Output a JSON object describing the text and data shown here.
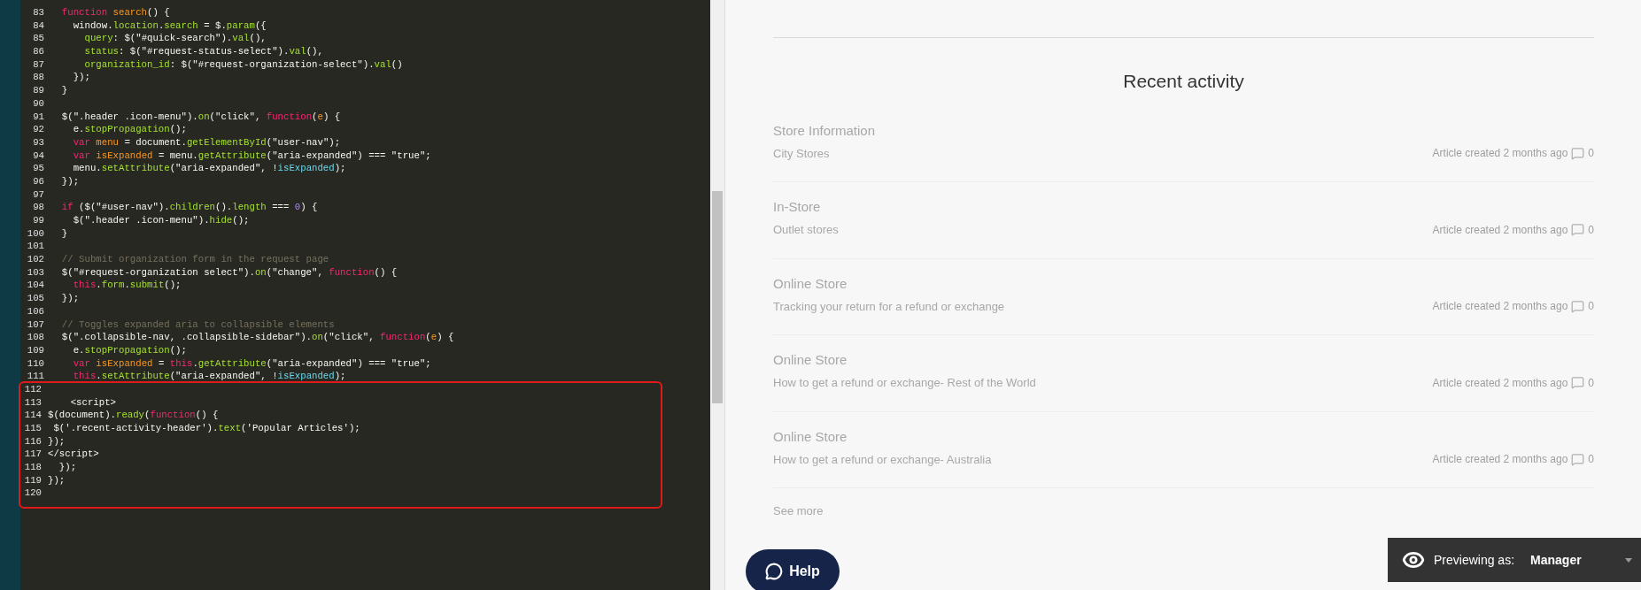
{
  "editor": {
    "code_blocks": [
      {
        "highlighted": false,
        "lines": [
          {
            "number": "83",
            "tokens": [
              {
                "kind": "kw",
                "text": "  function"
              },
              {
                "kind": "name",
                "text": " search"
              },
              {
                "kind": "plain",
                "text": "() {"
              }
            ]
          },
          {
            "number": "84",
            "tokens": [
              {
                "kind": "plain",
                "text": "    window."
              },
              {
                "kind": "fn",
                "text": "location"
              },
              {
                "kind": "plain",
                "text": "."
              },
              {
                "kind": "fn",
                "text": "search"
              },
              {
                "kind": "plain",
                "text": " = $."
              },
              {
                "kind": "fn",
                "text": "param"
              },
              {
                "kind": "plain",
                "text": "({"
              }
            ]
          },
          {
            "number": "85",
            "tokens": [
              {
                "kind": "fn",
                "text": "      query"
              },
              {
                "kind": "plain",
                "text": ": $(\"#quick-search\")."
              },
              {
                "kind": "fn",
                "text": "val"
              },
              {
                "kind": "plain",
                "text": "(),"
              }
            ]
          },
          {
            "number": "86",
            "tokens": [
              {
                "kind": "fn",
                "text": "      status"
              },
              {
                "kind": "plain",
                "text": ": $(\"#request-status-select\")."
              },
              {
                "kind": "fn",
                "text": "val"
              },
              {
                "kind": "plain",
                "text": "(),"
              }
            ]
          },
          {
            "number": "87",
            "tokens": [
              {
                "kind": "fn",
                "text": "      organization_id"
              },
              {
                "kind": "plain",
                "text": ": $(\"#request-organization-select\")."
              },
              {
                "kind": "fn",
                "text": "val"
              },
              {
                "kind": "plain",
                "text": "()"
              }
            ]
          },
          {
            "number": "88",
            "tokens": [
              {
                "kind": "plain",
                "text": "    });"
              }
            ]
          },
          {
            "number": "89",
            "tokens": [
              {
                "kind": "plain",
                "text": "  }"
              }
            ]
          },
          {
            "number": "90"
          },
          {
            "number": "91",
            "tokens": [
              {
                "kind": "plain",
                "text": "  $(\".header .icon-menu\")."
              },
              {
                "kind": "fn",
                "text": "on"
              },
              {
                "kind": "plain",
                "text": "(\"click\", "
              },
              {
                "kind": "kw",
                "text": "function"
              },
              {
                "kind": "plain",
                "text": "("
              },
              {
                "kind": "name",
                "text": "e"
              },
              {
                "kind": "plain",
                "text": ") {"
              }
            ]
          },
          {
            "number": "92",
            "tokens": [
              {
                "kind": "plain",
                "text": "    e."
              },
              {
                "kind": "fn",
                "text": "stopPropagation"
              },
              {
                "kind": "plain",
                "text": "();"
              }
            ]
          },
          {
            "number": "93",
            "tokens": [
              {
                "kind": "kw",
                "text": "    var"
              },
              {
                "kind": "name",
                "text": " menu"
              },
              {
                "kind": "plain",
                "text": " = document."
              },
              {
                "kind": "fn",
                "text": "getElementById"
              },
              {
                "kind": "plain",
                "text": "(\"user-nav\");"
              }
            ]
          },
          {
            "number": "94",
            "tokens": [
              {
                "kind": "kw",
                "text": "    var"
              },
              {
                "kind": "name",
                "text": " isExpanded"
              },
              {
                "kind": "plain",
                "text": " = menu."
              },
              {
                "kind": "fn",
                "text": "getAttribute"
              },
              {
                "kind": "plain",
                "text": "(\"aria-expanded\") === \"true\";"
              }
            ]
          },
          {
            "number": "95",
            "tokens": [
              {
                "kind": "plain",
                "text": "    menu."
              },
              {
                "kind": "fn",
                "text": "setAttribute"
              },
              {
                "kind": "plain",
                "text": "(\"aria-expanded\", !"
              },
              {
                "kind": "builtin",
                "text": "isExpanded"
              },
              {
                "kind": "plain",
                "text": ");"
              }
            ]
          },
          {
            "number": "96",
            "tokens": [
              {
                "kind": "plain",
                "text": "  });"
              }
            ]
          },
          {
            "number": "97"
          },
          {
            "number": "98",
            "tokens": [
              {
                "kind": "kw",
                "text": "  if"
              },
              {
                "kind": "plain",
                "text": " ($(\"#user-nav\")."
              },
              {
                "kind": "fn",
                "text": "children"
              },
              {
                "kind": "plain",
                "text": "()."
              },
              {
                "kind": "fn",
                "text": "length"
              },
              {
                "kind": "plain",
                "text": " === "
              },
              {
                "kind": "num",
                "text": "0"
              },
              {
                "kind": "plain",
                "text": ") {"
              }
            ]
          },
          {
            "number": "99",
            "tokens": [
              {
                "kind": "plain",
                "text": "    $(\".header .icon-menu\")."
              },
              {
                "kind": "fn",
                "text": "hide"
              },
              {
                "kind": "plain",
                "text": "();"
              }
            ]
          },
          {
            "number": "100",
            "tokens": [
              {
                "kind": "plain",
                "text": "  }"
              }
            ]
          },
          {
            "number": "101"
          },
          {
            "number": "102",
            "tokens": [
              {
                "kind": "comment",
                "text": "  // Submit organization form in the request page"
              }
            ]
          },
          {
            "number": "103",
            "tokens": [
              {
                "kind": "plain",
                "text": "  $(\"#request-organization select\")."
              },
              {
                "kind": "fn",
                "text": "on"
              },
              {
                "kind": "plain",
                "text": "(\"change\", "
              },
              {
                "kind": "kw",
                "text": "function"
              },
              {
                "kind": "plain",
                "text": "() {"
              }
            ]
          },
          {
            "number": "104",
            "tokens": [
              {
                "kind": "kw",
                "text": "    this"
              },
              {
                "kind": "plain",
                "text": "."
              },
              {
                "kind": "fn",
                "text": "form"
              },
              {
                "kind": "plain",
                "text": "."
              },
              {
                "kind": "fn",
                "text": "submit"
              },
              {
                "kind": "plain",
                "text": "();"
              }
            ]
          },
          {
            "number": "105",
            "tokens": [
              {
                "kind": "plain",
                "text": "  });"
              }
            ]
          },
          {
            "number": "106"
          },
          {
            "number": "107",
            "tokens": [
              {
                "kind": "comment",
                "text": "  // Toggles expanded aria to collapsible elements"
              }
            ]
          },
          {
            "number": "108",
            "tokens": [
              {
                "kind": "plain",
                "text": "  $(\".collapsible-nav, .collapsible-sidebar\")."
              },
              {
                "kind": "fn",
                "text": "on"
              },
              {
                "kind": "plain",
                "text": "(\"click\", "
              },
              {
                "kind": "kw",
                "text": "function"
              },
              {
                "kind": "plain",
                "text": "("
              },
              {
                "kind": "name",
                "text": "e"
              },
              {
                "kind": "plain",
                "text": ") {"
              }
            ]
          },
          {
            "number": "109",
            "tokens": [
              {
                "kind": "plain",
                "text": "    e."
              },
              {
                "kind": "fn",
                "text": "stopPropagation"
              },
              {
                "kind": "plain",
                "text": "();"
              }
            ]
          },
          {
            "number": "110",
            "tokens": [
              {
                "kind": "kw",
                "text": "    var"
              },
              {
                "kind": "name",
                "text": " isExpanded"
              },
              {
                "kind": "plain",
                "text": " = "
              },
              {
                "kind": "kw",
                "text": "this"
              },
              {
                "kind": "plain",
                "text": "."
              },
              {
                "kind": "fn",
                "text": "getAttribute"
              },
              {
                "kind": "plain",
                "text": "(\"aria-expanded\") === \"true\";"
              }
            ]
          },
          {
            "number": "111",
            "tokens": [
              {
                "kind": "kw",
                "text": "    this"
              },
              {
                "kind": "plain",
                "text": "."
              },
              {
                "kind": "fn",
                "text": "setAttribute"
              },
              {
                "kind": "plain",
                "text": "(\"aria-expanded\", !"
              },
              {
                "kind": "builtin",
                "text": "isExpanded"
              },
              {
                "kind": "plain",
                "text": ");"
              }
            ]
          }
        ]
      },
      {
        "highlighted": true,
        "lines": [
          {
            "number": "112"
          },
          {
            "number": "113",
            "tokens": [
              {
                "kind": "plain",
                "text": "    <script>"
              }
            ]
          },
          {
            "number": "114",
            "tokens": [
              {
                "kind": "plain",
                "text": "$(document)."
              },
              {
                "kind": "fn",
                "text": "ready"
              },
              {
                "kind": "plain",
                "text": "("
              },
              {
                "kind": "kw",
                "text": "function"
              },
              {
                "kind": "plain",
                "text": "() {"
              }
            ]
          },
          {
            "number": "115",
            "tokens": [
              {
                "kind": "plain",
                "text": " $('.recent-activity-header')."
              },
              {
                "kind": "fn",
                "text": "text"
              },
              {
                "kind": "plain",
                "text": "('Popular Articles');"
              }
            ]
          },
          {
            "number": "116",
            "tokens": [
              {
                "kind": "plain",
                "text": "});"
              }
            ]
          },
          {
            "number": "117",
            "tokens": [
              {
                "kind": "plain",
                "text": "</script>"
              }
            ]
          },
          {
            "number": "118",
            "tokens": [
              {
                "kind": "plain",
                "text": "  });"
              }
            ]
          },
          {
            "number": "119",
            "tokens": [
              {
                "kind": "plain",
                "text": "});"
              }
            ]
          },
          {
            "number": "120"
          }
        ]
      }
    ]
  },
  "recent_activity": {
    "title": "Recent activity",
    "items": [
      {
        "title": "Store Information",
        "subtitle": "City Stores",
        "meta": "Article created 2 months ago",
        "comment_count": "0"
      },
      {
        "title": "In-Store",
        "subtitle": "Outlet stores",
        "meta": "Article created 2 months ago",
        "comment_count": "0"
      },
      {
        "title": "Online Store",
        "subtitle": "Tracking your return for a refund or exchange",
        "meta": "Article created 2 months ago",
        "comment_count": "0"
      },
      {
        "title": "Online Store",
        "subtitle": "How to get a refund or exchange- Rest of the World",
        "meta": "Article created 2 months ago",
        "comment_count": "0"
      },
      {
        "title": "Online Store",
        "subtitle": "How to get a refund or exchange- Australia",
        "meta": "Article created 2 months ago",
        "comment_count": "0"
      }
    ],
    "see_more": "See more"
  },
  "help_button": {
    "label": "Help"
  },
  "preview_bar": {
    "label": "Previewing as:",
    "role": "Manager"
  }
}
